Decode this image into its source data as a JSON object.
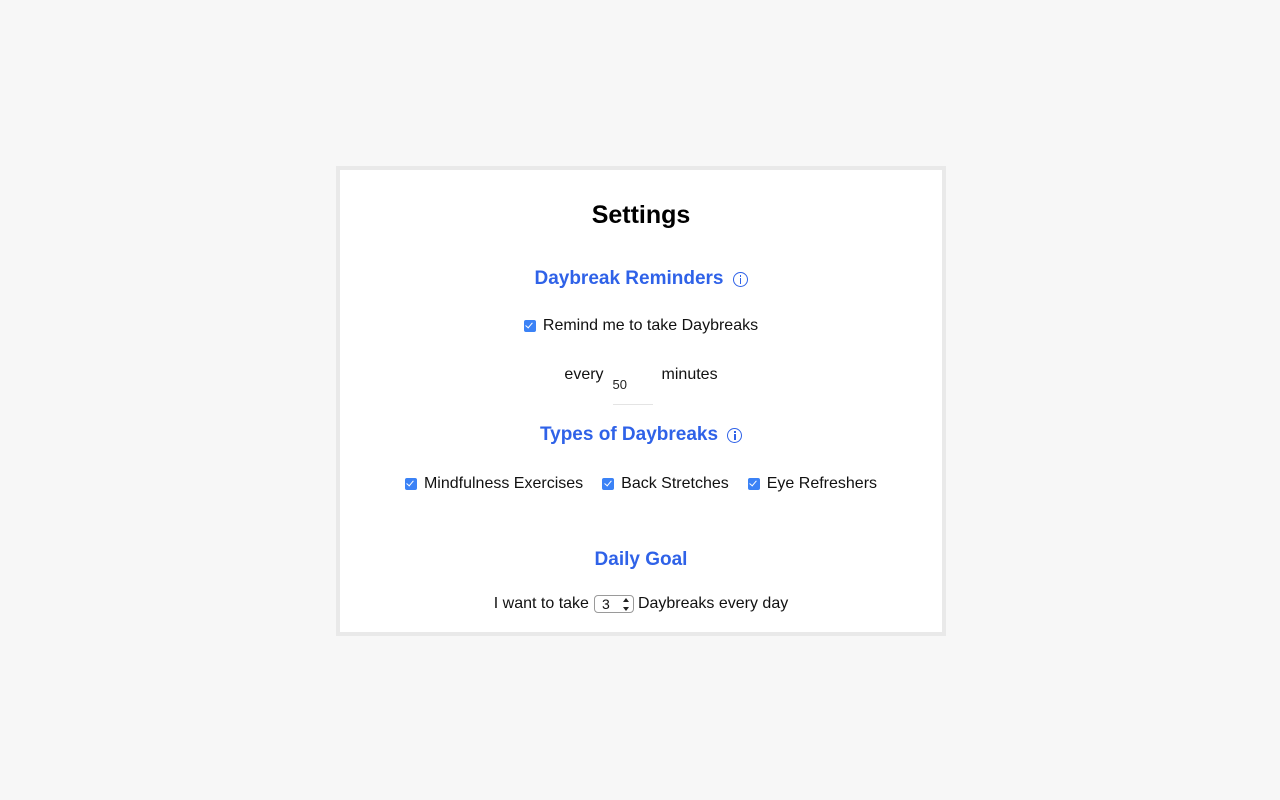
{
  "settings": {
    "title": "Settings",
    "reminders": {
      "heading": "Daybreak Reminders",
      "remind_label": "Remind me to take Daybreaks",
      "remind_checked": true,
      "every_label": "every",
      "interval_value": "50",
      "minutes_label": "minutes"
    },
    "types": {
      "heading": "Types of Daybreaks",
      "options": [
        {
          "label": "Mindfulness Exercises",
          "checked": true
        },
        {
          "label": "Back Stretches",
          "checked": true
        },
        {
          "label": "Eye Refreshers",
          "checked": true
        }
      ]
    },
    "goal": {
      "heading": "Daily Goal",
      "prefix": "I want to take",
      "selected": "3",
      "suffix": "Daybreaks every day"
    }
  },
  "icons": {
    "info": "info-circle-icon",
    "checkbox": "checkbox-checked-icon",
    "select_arrows": "up-down-arrows-icon"
  },
  "colors": {
    "accent": "#2f62e8",
    "checkbox": "#3b82f6",
    "background": "#f7f7f7",
    "panel_border": "#e9e9e9"
  }
}
